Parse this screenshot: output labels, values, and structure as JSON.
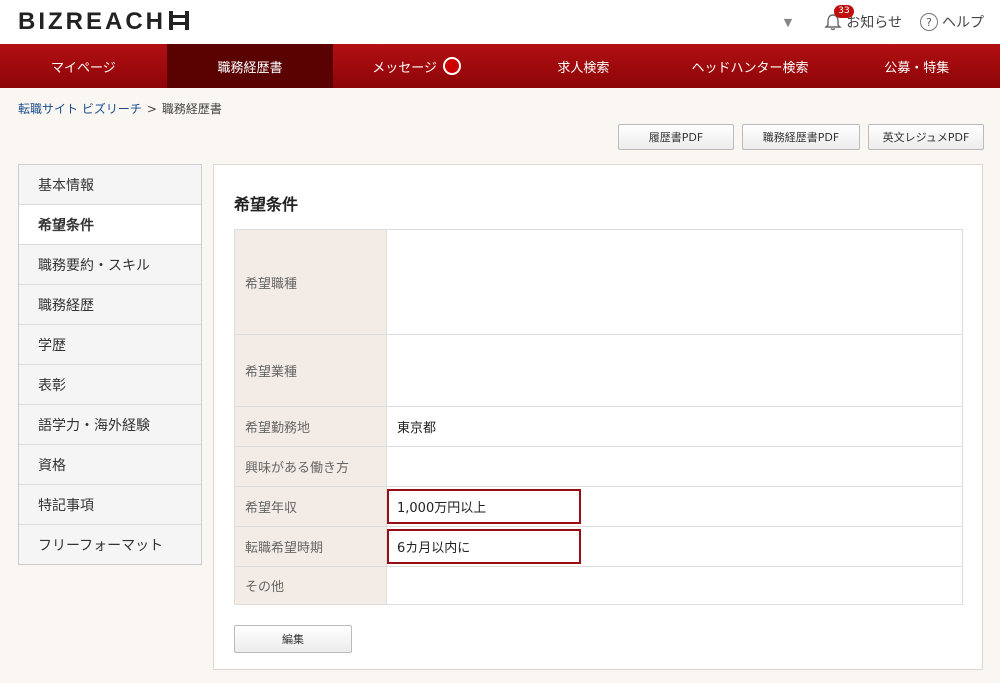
{
  "header": {
    "logo": "BIZREACH",
    "notification_count": "33",
    "notifications_label": "お知らせ",
    "help_label": "ヘルプ"
  },
  "nav": {
    "items": [
      {
        "label": "マイページ"
      },
      {
        "label": "職務経歴書"
      },
      {
        "label": "メッセージ"
      },
      {
        "label": "求人検索"
      },
      {
        "label": "ヘッドハンター検索"
      },
      {
        "label": "公募・特集"
      }
    ]
  },
  "breadcrumb": {
    "home": "転職サイト ビズリーチ",
    "separator": ">",
    "current": "職務経歴書"
  },
  "pdf_buttons": {
    "resume": "履歴書PDF",
    "career": "職務経歴書PDF",
    "english": "英文レジュメPDF"
  },
  "sidebar": {
    "items": [
      {
        "label": "基本情報"
      },
      {
        "label": "希望条件"
      },
      {
        "label": "職務要約・スキル"
      },
      {
        "label": "職務経歴"
      },
      {
        "label": "学歴"
      },
      {
        "label": "表彰"
      },
      {
        "label": "語学力・海外経験"
      },
      {
        "label": "資格"
      },
      {
        "label": "特記事項"
      },
      {
        "label": "フリーフォーマット"
      }
    ]
  },
  "main": {
    "title": "希望条件",
    "rows": [
      {
        "label": "希望職種",
        "value": ""
      },
      {
        "label": "希望業種",
        "value": ""
      },
      {
        "label": "希望勤務地",
        "value": "東京都"
      },
      {
        "label": "興味がある働き方",
        "value": ""
      },
      {
        "label": "希望年収",
        "value": "1,000万円以上"
      },
      {
        "label": "転職希望時期",
        "value": "6カ月以内に"
      },
      {
        "label": "その他",
        "value": ""
      }
    ],
    "edit_label": "編集"
  },
  "colors": {
    "brand_red": "#a30a0d",
    "nav_active": "#5a0202",
    "highlight_border": "#9b0d14"
  }
}
